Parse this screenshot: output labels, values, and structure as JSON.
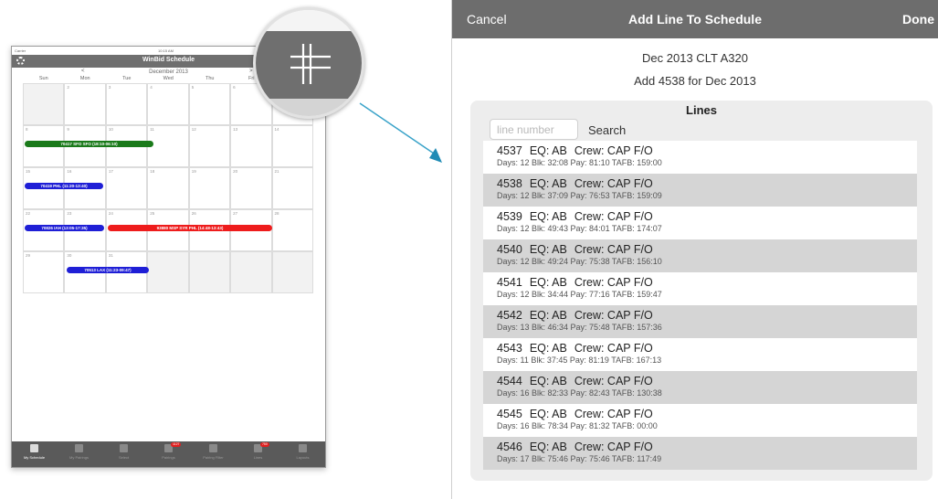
{
  "calendar_app": {
    "status": {
      "carrier": "Carrier",
      "time": "10:15 AM"
    },
    "title": "WinBid Schedule",
    "month": "December 2013",
    "prev": "<",
    "next": ">",
    "weekdays": [
      "Sun",
      "Mon",
      "Tue",
      "Wed",
      "Thu",
      "Fri"
    ],
    "weeks": [
      [
        "",
        "2",
        "3",
        "4",
        "5",
        "6",
        ""
      ],
      [
        "8",
        "9",
        "10",
        "11",
        "12",
        "13",
        "14"
      ],
      [
        "15",
        "16",
        "17",
        "18",
        "19",
        "20",
        "21"
      ],
      [
        "22",
        "23",
        "24",
        "25",
        "26",
        "27",
        "28"
      ],
      [
        "29",
        "30",
        "31",
        "",
        "",
        "",
        ""
      ]
    ],
    "trips": [
      {
        "label": "70417 SFO SFO (18:10-06:10)",
        "color": "#1a7a1a"
      },
      {
        "label": "70419 PHL (11:20-13:40)",
        "color": "#1f1fd6"
      },
      {
        "label": "70826 IAH (13:05-17:35)",
        "color": "#1f1fd6"
      },
      {
        "label": "93880 MSP SYR PHL (14:48-13:43)",
        "color": "#ee1c1c"
      },
      {
        "label": "70513 LAX (11:23-09:47)",
        "color": "#1f1fd6"
      }
    ],
    "tabs": [
      {
        "label": "My Schedule",
        "badge": ""
      },
      {
        "label": "My Pairings",
        "badge": ""
      },
      {
        "label": "Select",
        "badge": ""
      },
      {
        "label": "Pairings",
        "badge": "1127"
      },
      {
        "label": "Pairing Filter",
        "badge": ""
      },
      {
        "label": "Lines",
        "badge": "750"
      },
      {
        "label": "Layouts",
        "badge": ""
      }
    ]
  },
  "modal": {
    "cancel": "Cancel",
    "title": "Add Line To Schedule",
    "done": "Done",
    "subtitle1": "Dec 2013 CLT A320",
    "subtitle2": "Add 4538 for Dec 2013",
    "panel_title": "Lines",
    "search_placeholder": "line number",
    "search_button": "Search",
    "lines": [
      {
        "number": "4537",
        "eq": "EQ: AB",
        "crew": "Crew: CAP F/O",
        "details": "Days: 12 Blk: 32:08  Pay: 81:10  TAFB: 159:00"
      },
      {
        "number": "4538",
        "eq": "EQ: AB",
        "crew": "Crew: CAP F/O",
        "details": "Days: 12 Blk: 37:09  Pay: 76:53  TAFB: 159:09"
      },
      {
        "number": "4539",
        "eq": "EQ: AB",
        "crew": "Crew: CAP F/O",
        "details": "Days: 12 Blk: 49:43  Pay: 84:01  TAFB: 174:07"
      },
      {
        "number": "4540",
        "eq": "EQ: AB",
        "crew": "Crew: CAP F/O",
        "details": "Days: 12 Blk: 49:24  Pay: 75:38  TAFB: 156:10"
      },
      {
        "number": "4541",
        "eq": "EQ: AB",
        "crew": "Crew: CAP F/O",
        "details": "Days: 12 Blk: 34:44  Pay: 77:16  TAFB: 159:47"
      },
      {
        "number": "4542",
        "eq": "EQ: AB",
        "crew": "Crew: CAP F/O",
        "details": "Days: 13 Blk: 46:34  Pay: 75:48  TAFB: 157:36"
      },
      {
        "number": "4543",
        "eq": "EQ: AB",
        "crew": "Crew: CAP F/O",
        "details": "Days: 11 Blk: 37:45  Pay: 81:19  TAFB: 167:13"
      },
      {
        "number": "4544",
        "eq": "EQ: AB",
        "crew": "Crew: CAP F/O",
        "details": "Days: 16 Blk: 82:33  Pay: 82:43  TAFB: 130:38"
      },
      {
        "number": "4545",
        "eq": "EQ: AB",
        "crew": "Crew: CAP F/O",
        "details": "Days: 16 Blk: 78:34  Pay: 81:32  TAFB: 00:00"
      },
      {
        "number": "4546",
        "eq": "EQ: AB",
        "crew": "Crew: CAP F/O",
        "details": "Days: 17 Blk: 75:46  Pay: 75:46  TAFB: 117:49"
      }
    ]
  }
}
